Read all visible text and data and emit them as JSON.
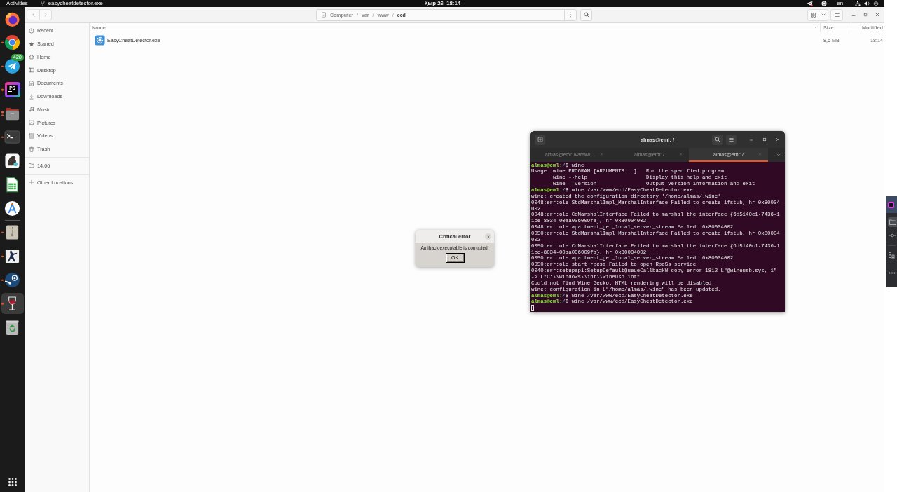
{
  "top_bar": {
    "activities": "Activities",
    "app_name": "easycheatdetector.exe",
    "clock": "Қыр 26  18:14",
    "keyboard_layout": "en"
  },
  "dock": {
    "pinned": [
      {
        "kind": "fox",
        "running": false,
        "selected": false
      },
      {
        "kind": "wheel",
        "running": true,
        "multiple_windows": false,
        "selected": false
      },
      {
        "kind": "plane",
        "running": true,
        "multiple_windows": false,
        "selected": false,
        "badge": "420"
      },
      {
        "kind": "ide",
        "running": true,
        "multiple_windows": false,
        "selected": false,
        "logo_text": "PS"
      },
      {
        "kind": "files",
        "running": true,
        "multiple_windows": true,
        "selected": false
      },
      {
        "kind": "terminal",
        "running": true,
        "multiple_windows": false,
        "selected": false
      },
      {
        "kind": "drawing",
        "running": false,
        "selected": false
      },
      {
        "kind": "sheet",
        "running": false,
        "selected": false
      },
      {
        "kind": "store",
        "running": false,
        "selected": false
      }
    ],
    "unpinned": [
      {
        "kind": "archive",
        "running": true,
        "multiple_windows": false,
        "selected": false
      },
      {
        "kind": "shooter",
        "running": true,
        "multiple_windows": false,
        "selected": false
      },
      {
        "kind": "steam",
        "running": true,
        "multiple_windows": false,
        "selected": false
      },
      {
        "kind": "wine",
        "running": true,
        "multiple_windows": false,
        "selected": true
      },
      {
        "kind": "trash",
        "running": false,
        "selected": false
      }
    ]
  },
  "file_manager": {
    "path_bar": {
      "separator": "/",
      "segments": [
        {
          "label": "Computer",
          "selected": false
        },
        {
          "label": "var",
          "selected": false
        },
        {
          "label": "www",
          "selected": false
        },
        {
          "label": "ecd",
          "selected": true
        }
      ]
    },
    "sidebar": {
      "places": [
        {
          "kind": "recent",
          "label": "Recent",
          "selected": false
        },
        {
          "kind": "starred",
          "label": "Starred",
          "selected": false
        },
        {
          "kind": "home",
          "label": "Home",
          "selected": false
        },
        {
          "kind": "desktop",
          "label": "Desktop",
          "selected": false
        },
        {
          "kind": "documents",
          "label": "Documents",
          "selected": false
        },
        {
          "kind": "downloads",
          "label": "Downloads",
          "selected": false
        },
        {
          "kind": "music",
          "label": "Music",
          "selected": false
        },
        {
          "kind": "pictures",
          "label": "Pictures",
          "selected": false
        },
        {
          "kind": "videos",
          "label": "Videos",
          "selected": false
        },
        {
          "kind": "trash",
          "label": "Trash",
          "selected": false
        }
      ],
      "bookmarks": [
        {
          "kind": "folder",
          "label": "14.06",
          "selected": false
        }
      ],
      "other": [
        {
          "kind": "add",
          "label": "Other Locations",
          "selected": false
        }
      ]
    },
    "columns": [
      "Name",
      "Size",
      "Modified"
    ],
    "files": [
      {
        "name": "EasyCheatDetector.exe",
        "size": "8,6 MB",
        "modified": "18:14"
      }
    ]
  },
  "terminal": {
    "title": "almas@eml: /",
    "tabs": [
      {
        "label": "almas@eml: /var/ww…",
        "selected": false
      },
      {
        "label": "almas@eml: /",
        "selected": false
      },
      {
        "label": "almas@eml: /",
        "selected": true
      }
    ],
    "lines": [
      {
        "kind": "prompt",
        "user": "almas@eml:",
        "path": "/",
        "command": "$ wine"
      },
      {
        "kind": "output",
        "text": "Usage: wine PROGRAM [ARGUMENTS...]   Run the specified program"
      },
      {
        "kind": "output",
        "text": "       wine --help                   Display this help and exit"
      },
      {
        "kind": "output",
        "text": "       wine --version                Output version information and exit"
      },
      {
        "kind": "prompt",
        "user": "almas@eml:",
        "path": "/",
        "command": "$ wine /var/www/ecd/EasyCheatDetector.exe"
      },
      {
        "kind": "output",
        "text": "wine: created the configuration directory '/home/almas/.wine'"
      },
      {
        "kind": "output",
        "text": "0048:err:ole:StdMarshalImpl_MarshalInterface Failed to create ifstub, hr 0x80004"
      },
      {
        "kind": "output",
        "text": "002"
      },
      {
        "kind": "output",
        "text": "0048:err:ole:CoMarshalInterface Failed to marshal the interface {6d5140c1-7436-1"
      },
      {
        "kind": "output",
        "text": "1ce-8034-00aa006009fa}, hr 0x80004002"
      },
      {
        "kind": "output",
        "text": "0048:err:ole:apartment_get_local_server_stream Failed: 0x80004002"
      },
      {
        "kind": "output",
        "text": "0050:err:ole:StdMarshalImpl_MarshalInterface Failed to create ifstub, hr 0x80004"
      },
      {
        "kind": "output",
        "text": "002"
      },
      {
        "kind": "output",
        "text": "0050:err:ole:CoMarshalInterface Failed to marshal the interface {6d5140c1-7436-1"
      },
      {
        "kind": "output",
        "text": "1ce-8034-00aa006009fa}, hr 0x80004002"
      },
      {
        "kind": "output",
        "text": "0050:err:ole:apartment_get_local_server_stream Failed: 0x80004002"
      },
      {
        "kind": "output",
        "text": "0050:err:ole:start_rpcss Failed to open RpcSs service"
      },
      {
        "kind": "output",
        "text": "0040:err:setupapi:SetupDefaultQueueCallbackW copy error 1812 L\"@wineusb.sys,-1\""
      },
      {
        "kind": "output",
        "text": "-> L\"C:\\\\windows\\\\inf\\\\wineusb.inf\""
      },
      {
        "kind": "output",
        "text": "Could not find Wine Gecko. HTML rendering will be disabled."
      },
      {
        "kind": "output",
        "text": "wine: configuration in L\"/home/almas/.wine\" has been updated."
      },
      {
        "kind": "prompt",
        "user": "almas@eml:",
        "path": "/",
        "command": "$ wine /var/www/ecd/EasyCheatDetector.exe"
      },
      {
        "kind": "prompt",
        "user": "almas@eml:",
        "path": "/",
        "command": "$ wine /var/www/ecd/EasyCheatDetector.exe"
      },
      {
        "kind": "cursor"
      }
    ]
  },
  "dialog": {
    "title": "Critical error",
    "message": "Antihack executable is corrupted!",
    "button": "OK"
  }
}
